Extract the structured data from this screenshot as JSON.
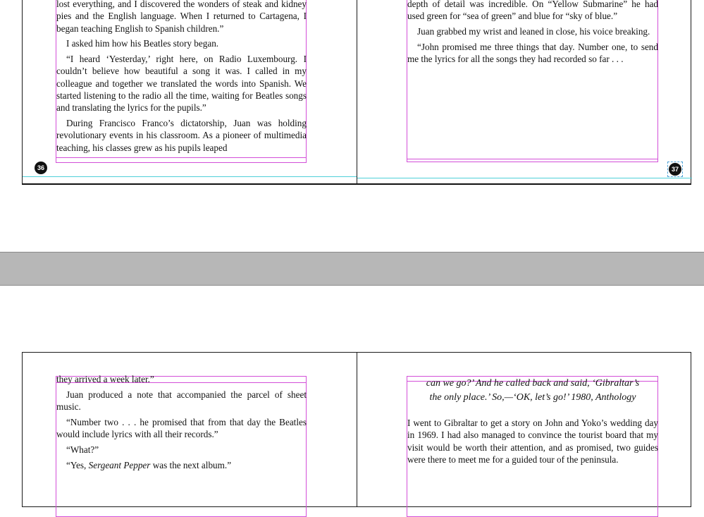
{
  "spread_top": {
    "left_page": {
      "folio": "36",
      "paragraphs": [
        "lost everything, and I discovered the wonders of steak and kidney pies and the English language. When I returned to Cartagena, I began teaching English to Spanish children.”",
        "I asked him how his Beatles story began.",
        "“I heard ‘Yesterday,’ right here, on Radio Luxembourg. I couldn’t believe how beautiful a song it was. I called in my colleague and together we translated the words into Spanish. We started listening to the radio all the time, waiting for Beatles songs and translating the lyrics for the pupils.”",
        "During Francisco Franco’s dictatorship, Juan was holding revolutionary events in his classroom. As a pioneer of multimedia teaching, his classes grew as his pupils leaped"
      ]
    },
    "right_page": {
      "folio": "37",
      "paragraphs": [
        "depth of detail was incredible. On “Yellow Submarine” he had used green for “sea of green” and blue for “sky of blue.”",
        "Juan grabbed my wrist and leaned in close, his voice breaking.",
        "“John promised me three things that day. Number one, to send me the lyrics for all the songs they had recorded so far . . ."
      ]
    }
  },
  "spread_bottom": {
    "left_page": {
      "paragraphs": [
        "they arrived a week later.”",
        "Juan produced a note that accompanied the parcel of sheet music.",
        "“Number two . . . he promised that from that day the Beatles would include lyrics with all their records.”",
        "“What?”"
      ],
      "last_para_prefix": "“Yes, ",
      "last_para_italic": "Sergeant Pepper",
      "last_para_suffix": " was the next album.”"
    },
    "right_page": {
      "quote_line_1": "can we go?’ And he called back and said, ‘Gibraltar’s",
      "quote_line_2": "the only place.’ So,—‘OK, let’s go!’ 1980, Anthology",
      "body": "I went to Gibraltar to get a story on John and Yoko’s wedding day in 1969. I had also managed to convince the tourist board that my visit would be worth their attention, and as promised, two guides were there to meet me for a guided tour of the peninsula."
    }
  },
  "colors": {
    "frame": "#d34fd8",
    "guide": "#4fd0d8",
    "pasteboard": "#b7b7b7"
  }
}
